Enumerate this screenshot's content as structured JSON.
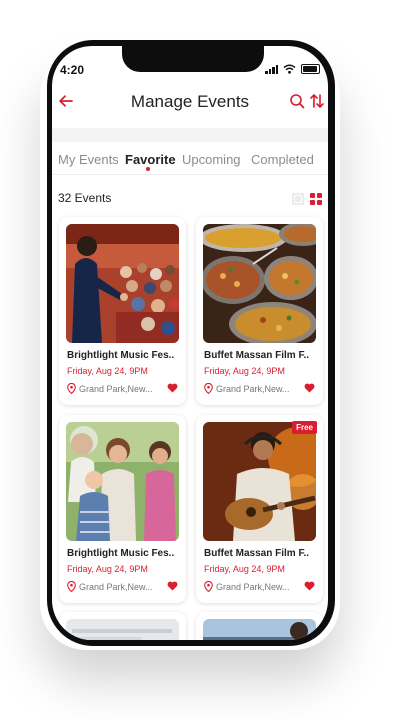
{
  "status": {
    "time": "4:20"
  },
  "header": {
    "title": "Manage Events"
  },
  "tabs": [
    {
      "label": "My Events",
      "active": false
    },
    {
      "label": "Favorite",
      "active": true
    },
    {
      "label": "Upcoming",
      "active": false
    },
    {
      "label": "Completed",
      "active": false
    }
  ],
  "events_count": "32 Events",
  "events": [
    {
      "name": "Brightlight Music Fes..",
      "date": "Friday, Aug 24, 9PM",
      "location": "Grand Park,New...",
      "badge": "",
      "image": "speaker-audience-photo"
    },
    {
      "name": "Buffet Massan Film F..",
      "date": "Friday, Aug 24, 9PM",
      "location": "Grand Park,New...",
      "badge": "",
      "image": "buffet-food-photo"
    },
    {
      "name": "Brightlight Music Fes..",
      "date": "Friday, Aug 24, 9PM",
      "location": "Grand Park,New...",
      "badge": "",
      "image": "family-photo"
    },
    {
      "name": "Buffet Massan Film F..",
      "date": "Friday, Aug 24, 9PM",
      "location": "Grand Park,New...",
      "badge": "Free",
      "image": "guitarist-photo"
    }
  ],
  "colors": {
    "accent": "#d91e2e",
    "text": "#222222",
    "muted": "#8c8c8c"
  }
}
